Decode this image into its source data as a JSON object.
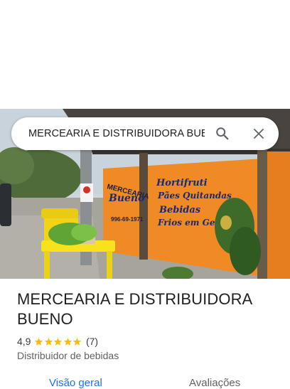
{
  "search": {
    "query": "MERCEARIA E DISTRIBUIDORA BUEN",
    "search_icon": "magnifier-icon",
    "close_icon": "close-icon"
  },
  "photo": {
    "sign_left_lines": [
      "MERCEARIA",
      "Bueno",
      "996-69-1971"
    ],
    "sign_right_lines": [
      "Hortifruti",
      "Pães Quitandas",
      "Bebidas",
      "Frios em Geral"
    ]
  },
  "place": {
    "name": "MERCEARIA E DISTRIBUIDORA BUENO",
    "rating": "4,9",
    "stars": 5,
    "review_count": "(7)",
    "category": "Distribuidor de bebidas"
  },
  "tabs": [
    {
      "label": "Visão geral"
    },
    {
      "label": "Avaliações"
    }
  ],
  "colors": {
    "accent": "#1a73e8",
    "star": "#fbbc04",
    "wall": "#f08a24"
  }
}
